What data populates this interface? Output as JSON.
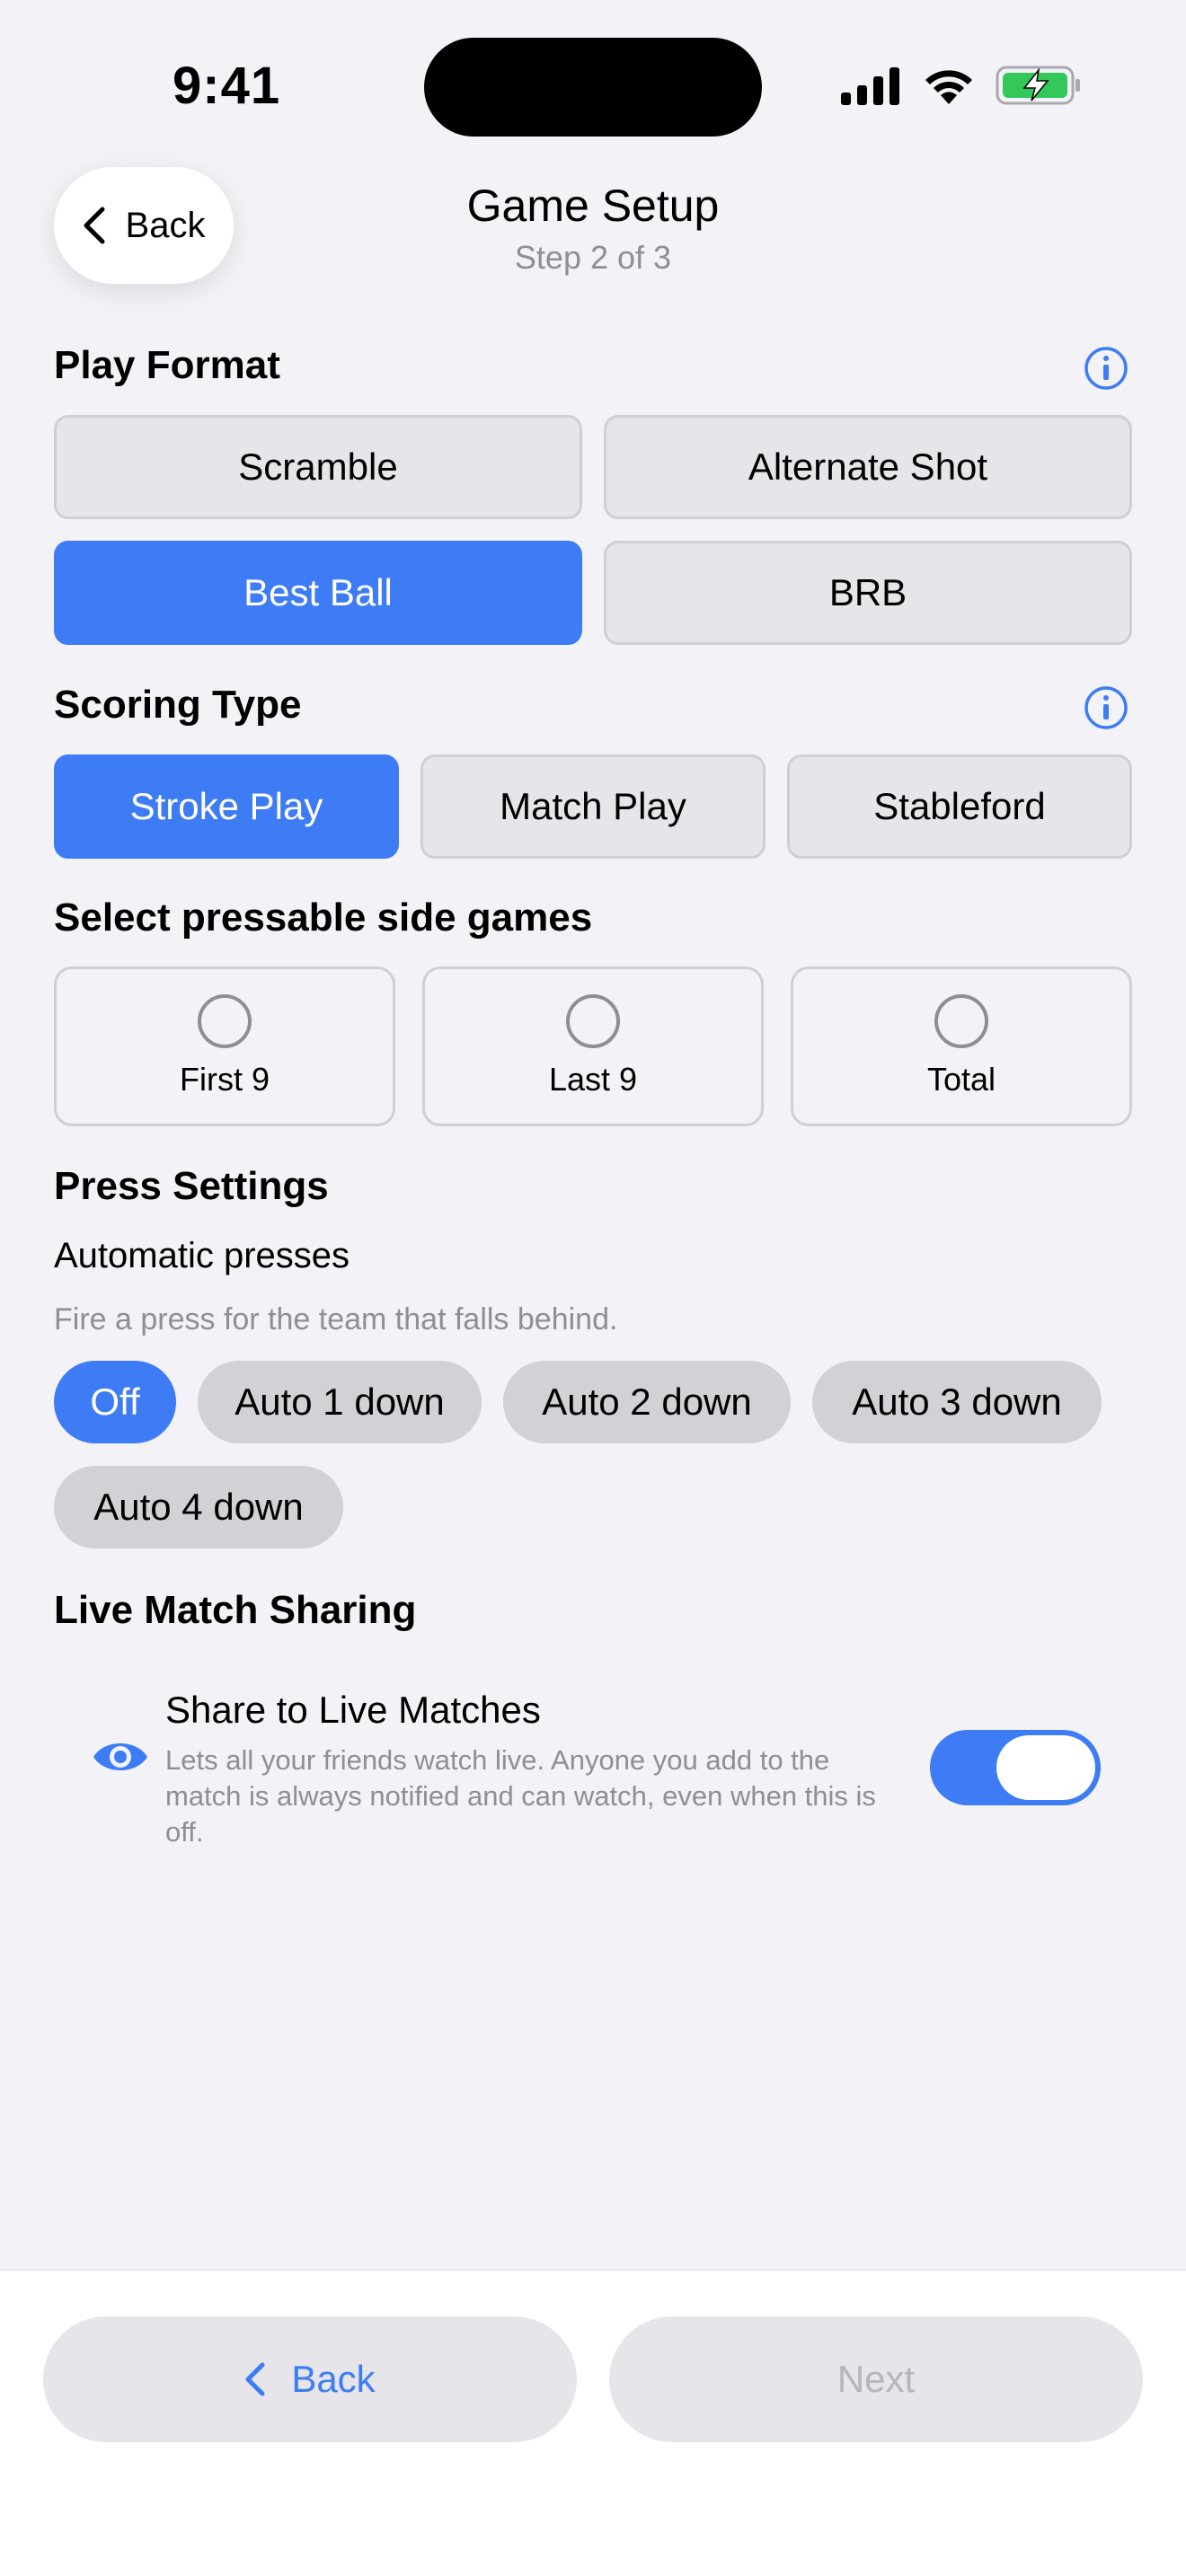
{
  "status": {
    "time": "9:41"
  },
  "header": {
    "back_label": "Back",
    "title": "Game Setup",
    "subtitle": "Step 2 of 3"
  },
  "play_format": {
    "title": "Play Format",
    "options": [
      "Scramble",
      "Alternate Shot",
      "Best Ball",
      "BRB"
    ],
    "selected": "Best Ball"
  },
  "scoring_type": {
    "title": "Scoring Type",
    "options": [
      "Stroke Play",
      "Match Play",
      "Stableford"
    ],
    "selected": "Stroke Play"
  },
  "side_games": {
    "title": "Select pressable side games",
    "options": [
      "First 9",
      "Last 9",
      "Total"
    ]
  },
  "press_settings": {
    "title": "Press Settings",
    "auto_title": "Automatic presses",
    "auto_hint": "Fire a press for the team that falls behind.",
    "options": [
      "Off",
      "Auto 1 down",
      "Auto 2 down",
      "Auto 3 down",
      "Auto 4 down"
    ],
    "selected": "Off"
  },
  "live_sharing": {
    "title": "Live Match Sharing",
    "share_title": "Share to Live Matches",
    "share_desc": "Lets all your friends watch live. Anyone you add to the match is always notified and can watch, even when this is off.",
    "enabled": true
  },
  "footer": {
    "back_label": "Back",
    "next_label": "Next"
  },
  "colors": {
    "accent": "#3d7cf5",
    "background": "#f2f2f7",
    "battery": "#34c759"
  }
}
